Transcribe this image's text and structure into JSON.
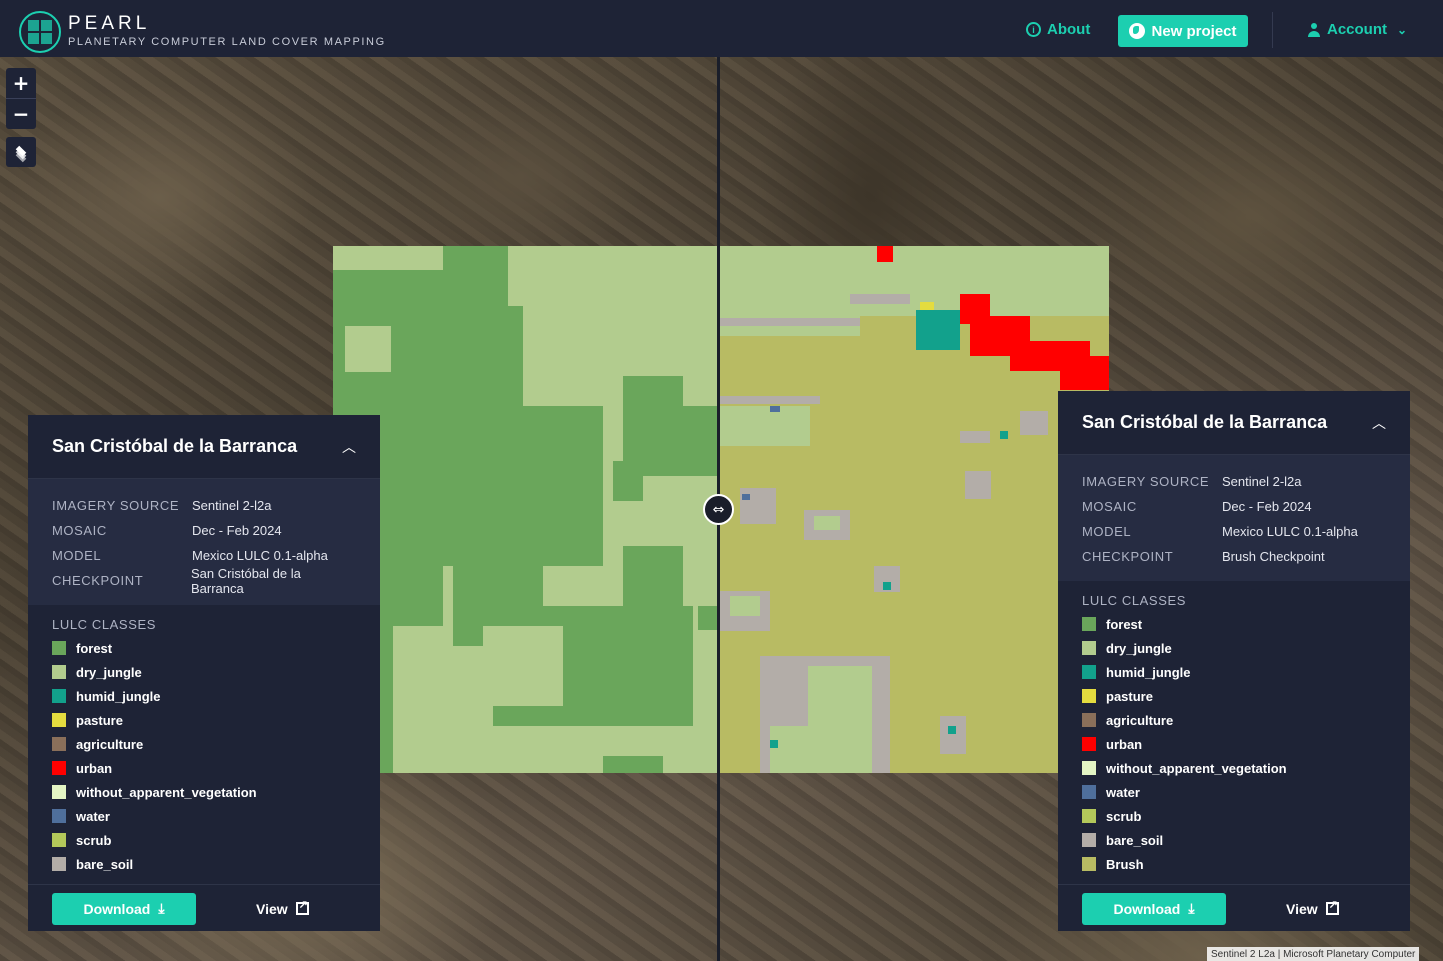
{
  "header": {
    "brand_title": "PEARL",
    "brand_subtitle": "PLANETARY COMPUTER LAND COVER MAPPING",
    "about_label": "About",
    "new_project_label": "New project",
    "account_label": "Account"
  },
  "map_controls": {
    "zoom_in": "+",
    "zoom_out": "−"
  },
  "left_panel": {
    "title": "San Cristóbal de la Barranca",
    "meta": [
      {
        "key": "IMAGERY SOURCE",
        "value": "Sentinel 2-l2a"
      },
      {
        "key": "MOSAIC",
        "value": "Dec - Feb 2024"
      },
      {
        "key": "MODEL",
        "value": "Mexico LULC 0.1-alpha"
      },
      {
        "key": "CHECKPOINT",
        "value": "San Cristóbal de la Barranca"
      }
    ],
    "classes_title": "LULC CLASSES",
    "classes": [
      {
        "name": "forest",
        "color": "#6aa65b"
      },
      {
        "name": "dry_jungle",
        "color": "#b2cc8e"
      },
      {
        "name": "humid_jungle",
        "color": "#12a18c"
      },
      {
        "name": "pasture",
        "color": "#e4dc3f"
      },
      {
        "name": "agriculture",
        "color": "#8a6f5a"
      },
      {
        "name": "urban",
        "color": "#ff0000"
      },
      {
        "name": "without_apparent_vegetation",
        "color": "#e4f5c4"
      },
      {
        "name": "water",
        "color": "#4f6f9c"
      },
      {
        "name": "scrub",
        "color": "#b3c85a"
      },
      {
        "name": "bare_soil",
        "color": "#b3ada8"
      }
    ],
    "download_label": "Download",
    "view_label": "View"
  },
  "right_panel": {
    "title": "San Cristóbal de la Barranca",
    "meta": [
      {
        "key": "IMAGERY SOURCE",
        "value": "Sentinel 2-l2a"
      },
      {
        "key": "MOSAIC",
        "value": "Dec - Feb 2024"
      },
      {
        "key": "MODEL",
        "value": "Mexico LULC 0.1-alpha"
      },
      {
        "key": "CHECKPOINT",
        "value": "Brush Checkpoint"
      }
    ],
    "classes_title": "LULC CLASSES",
    "classes": [
      {
        "name": "forest",
        "color": "#6aa65b"
      },
      {
        "name": "dry_jungle",
        "color": "#b2cc8e"
      },
      {
        "name": "humid_jungle",
        "color": "#12a18c"
      },
      {
        "name": "pasture",
        "color": "#e4dc3f"
      },
      {
        "name": "agriculture",
        "color": "#8a6f5a"
      },
      {
        "name": "urban",
        "color": "#ff0000"
      },
      {
        "name": "without_apparent_vegetation",
        "color": "#e4f5c4"
      },
      {
        "name": "water",
        "color": "#4f6f9c"
      },
      {
        "name": "scrub",
        "color": "#b3c85a"
      },
      {
        "name": "bare_soil",
        "color": "#b3ada8"
      },
      {
        "name": "Brush",
        "color": "#b8bb63"
      }
    ],
    "download_label": "Download",
    "view_label": "View"
  },
  "attribution": "Sentinel 2 L2a | Microsoft Planetary Computer"
}
